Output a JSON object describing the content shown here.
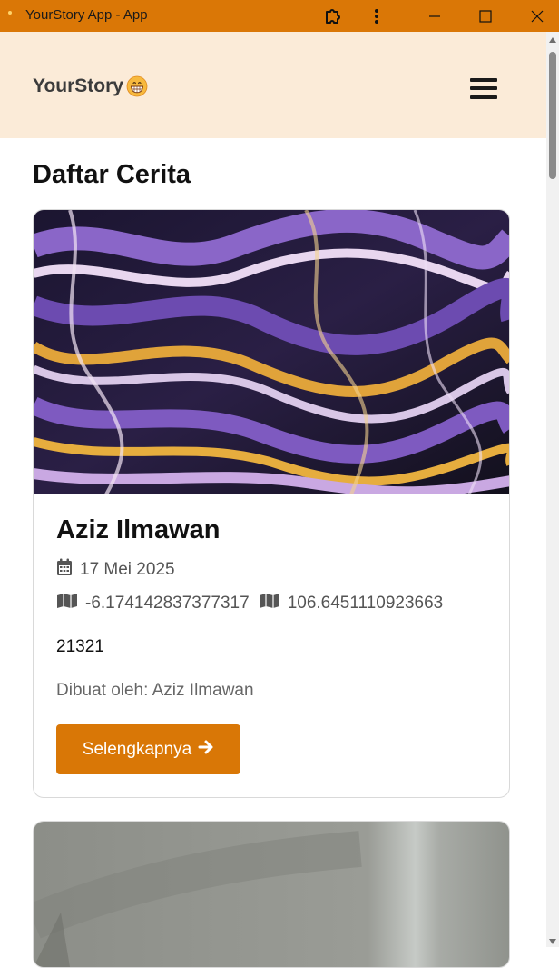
{
  "window": {
    "title": "YourStory App - App",
    "icons": [
      "extension-icon",
      "more-icon",
      "minimize-icon",
      "maximize-icon",
      "close-icon"
    ]
  },
  "header": {
    "brand": "YourStory",
    "brand_emoji": "grinning-face-emoji",
    "menu_icon": "hamburger-icon"
  },
  "main": {
    "title": "Daftar Cerita",
    "stories": [
      {
        "name": "Aziz Ilmawan",
        "date": "17 Mei 2025",
        "lat": "-6.174142837377317",
        "lon": "106.6451110923663",
        "description": "21321",
        "author": "Dibuat oleh: Aziz Ilmawan",
        "button_label": "Selengkapnya",
        "image": "abstract-marble-swirl"
      },
      {
        "image": "gray-photo"
      }
    ]
  },
  "colors": {
    "accent": "#d97706",
    "titlebar": "#da7706",
    "header_bg": "#fbebd8"
  }
}
